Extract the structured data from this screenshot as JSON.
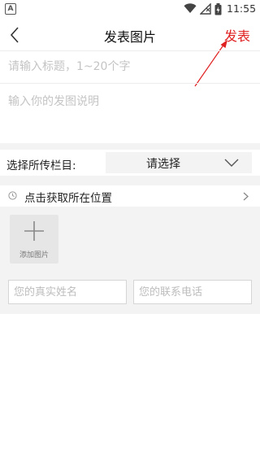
{
  "status_bar": {
    "app_icon_letter": "A",
    "time": "11:55",
    "icons": [
      "wifi-icon",
      "signal-icon",
      "battery-icon"
    ]
  },
  "nav": {
    "back_icon": "chevron-left-icon",
    "title": "发表图片",
    "publish_label": "发表",
    "publish_color": "#e02020"
  },
  "form": {
    "title_placeholder": "请输入标题，1~20个字",
    "desc_placeholder": "输入你的发图说明",
    "column_label": "选择所传栏目:",
    "column_select_value": "请选择",
    "location_text": "点击获取所在位置",
    "add_image_label": "添加图片",
    "name_placeholder": "您的真实姓名",
    "phone_placeholder": "您的联系电话"
  }
}
